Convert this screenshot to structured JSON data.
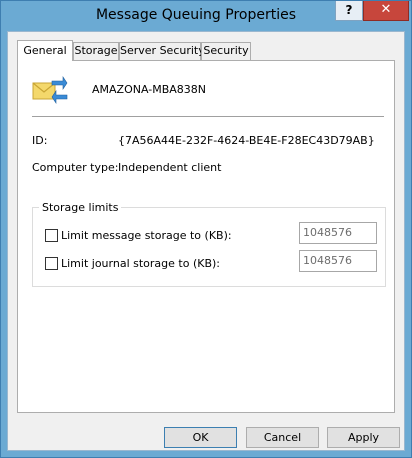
{
  "window": {
    "title": "Message Queuing Properties",
    "help_label": "?",
    "close_label": "✕"
  },
  "tabs": [
    {
      "label": "General",
      "active": true
    },
    {
      "label": "Storage",
      "active": false
    },
    {
      "label": "Server Security",
      "active": false
    },
    {
      "label": "Security",
      "active": false
    }
  ],
  "general": {
    "computer_name": "AMAZONA-MBA838N",
    "id_label": "ID:",
    "id_value": "{7A56A44E-232F-4624-BE4E-F28EC43D79AB}",
    "computer_type_label": "Computer type:",
    "computer_type_value": "Independent client"
  },
  "storage_limits": {
    "title": "Storage limits",
    "message": {
      "label": "Limit message storage to (KB):",
      "checked": false,
      "value": "1048576"
    },
    "journal": {
      "label": "Limit journal storage to (KB):",
      "checked": false,
      "value": "1048576"
    }
  },
  "buttons": {
    "ok": "OK",
    "cancel": "Cancel",
    "apply": "Apply"
  },
  "icons": {
    "title_help": "help-icon",
    "title_close": "close-icon",
    "message_queuing": "message-queuing-icon"
  },
  "colors": {
    "titlebar": "#6baad3",
    "close_button": "#c7463c",
    "dialog_background": "#f0f0f0",
    "panel_background": "#ffffff",
    "disabled_text": "#6d6d6d"
  }
}
